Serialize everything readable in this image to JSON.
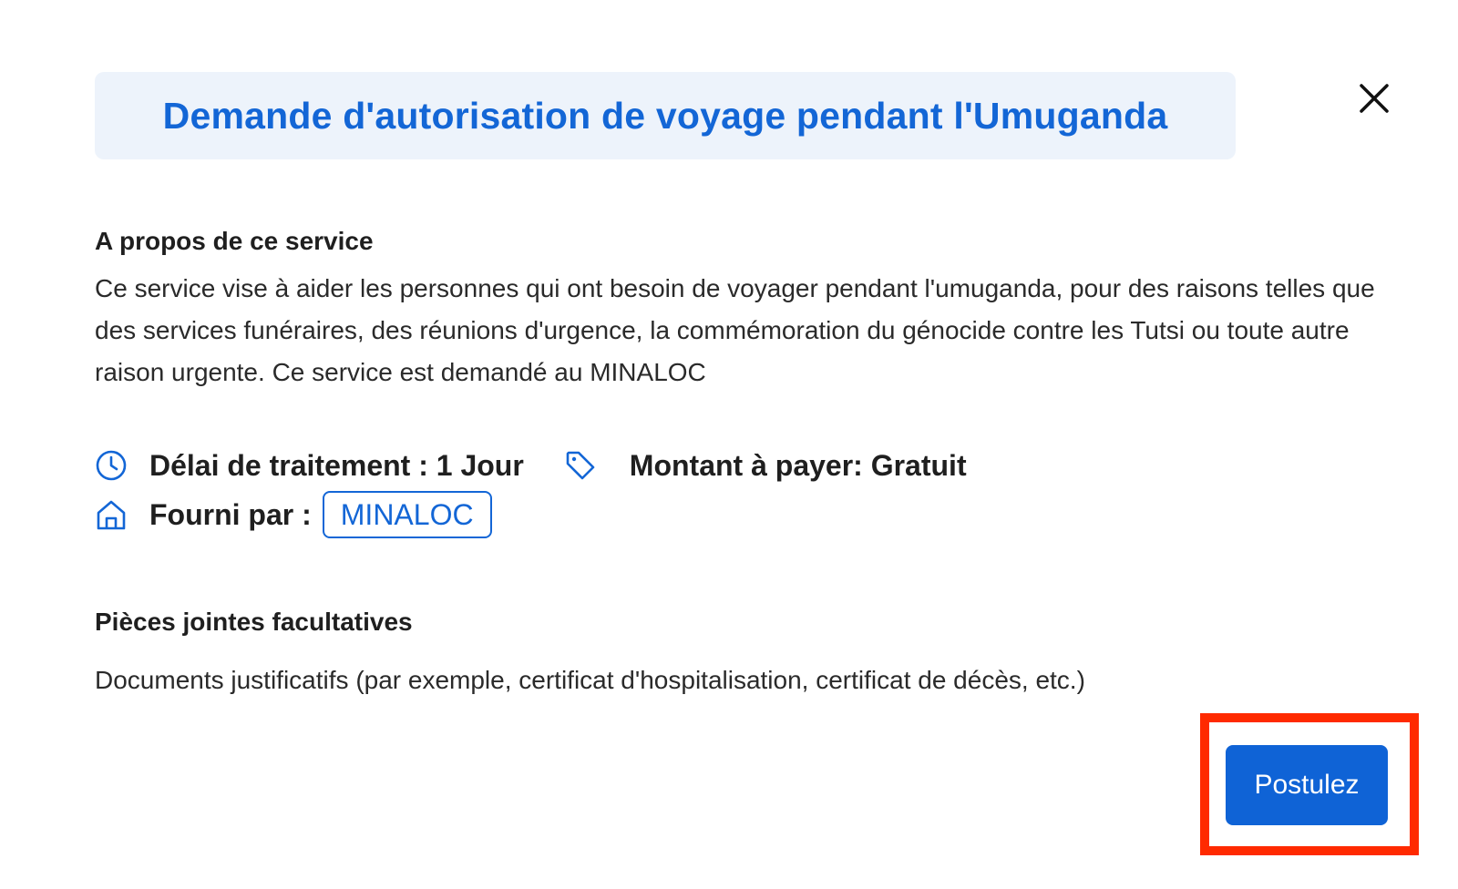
{
  "modal": {
    "title": "Demande d'autorisation de voyage pendant l'Umuganda",
    "close_icon": "close-icon"
  },
  "about": {
    "heading": "A propos de ce service",
    "description": "Ce service vise à aider les personnes qui ont besoin de voyager pendant l'umuganda, pour des raisons telles que des services funéraires, des réunions d'urgence, la commémoration du génocide contre les Tutsi ou toute autre raison urgente. Ce service est demandé au MINALOC"
  },
  "meta": {
    "processing_time": "Délai de traitement : 1 Jour",
    "amount": "Montant à payer: Gratuit",
    "provided_by_label": "Fourni par :",
    "provider": "MINALOC",
    "icons": [
      "clock-icon",
      "tag-icon",
      "home-icon"
    ]
  },
  "attachments": {
    "heading": "Pièces jointes facultatives",
    "description": "Documents justificatifs (par exemple, certificat d'hospitalisation, certificat de décès, etc.)"
  },
  "actions": {
    "apply_label": "Postulez"
  },
  "colors": {
    "accent": "#1366d6",
    "title_background": "#edf3fb",
    "button": "#0f63d6",
    "highlight": "#ff2a00"
  }
}
